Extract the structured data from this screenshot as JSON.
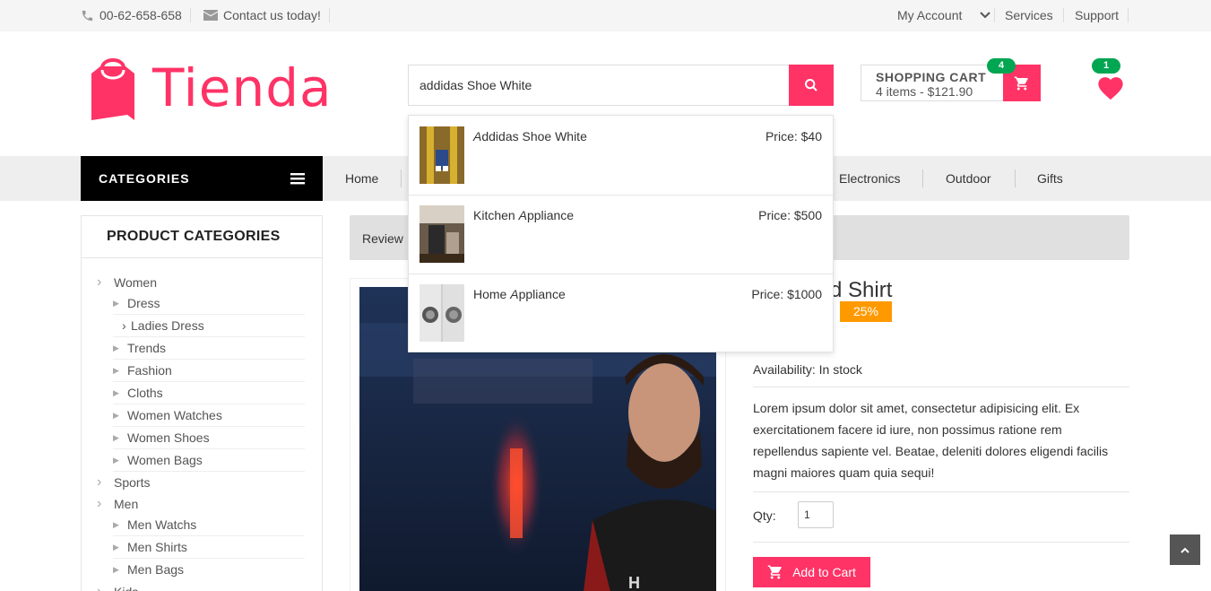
{
  "topbar": {
    "phone": "00-62-658-658",
    "contact": "Contact us today!",
    "account": "My Account",
    "services": "Services",
    "support": "Support"
  },
  "header": {
    "logo_text": "Tienda",
    "search_value": "addidas Shoe White",
    "cart_title": "SHOPPING CART",
    "cart_summary": "4 items - $121.90",
    "cart_count": "4",
    "wishlist_count": "1"
  },
  "nav": {
    "categories_label": "CATEGORIES",
    "links": [
      "Home",
      "Electronics",
      "Outdoor",
      "Gifts"
    ]
  },
  "sidebar": {
    "title": "PRODUCT CATEGORIES",
    "items": [
      {
        "label": "Women",
        "level": 0
      },
      {
        "label": "Dress",
        "level": 1
      },
      {
        "label": "Ladies Dress",
        "level": 2
      },
      {
        "label": "Trends",
        "level": 1
      },
      {
        "label": "Fashion",
        "level": 1
      },
      {
        "label": "Cloths",
        "level": 1
      },
      {
        "label": "Women Watches",
        "level": 1
      },
      {
        "label": "Women Shoes",
        "level": 1
      },
      {
        "label": "Women Bags",
        "level": 1
      },
      {
        "label": "Sports",
        "level": 0
      },
      {
        "label": "Men",
        "level": 0
      },
      {
        "label": "Men Watchs",
        "level": 1
      },
      {
        "label": "Men Shirts",
        "level": 1
      },
      {
        "label": "Men Bags",
        "level": 1
      },
      {
        "label": "Kids",
        "level": 0
      }
    ]
  },
  "breadcrumb": {
    "label": "Review"
  },
  "product": {
    "title": "d Shirt",
    "discount": "25%",
    "availability": "Availability: In stock",
    "description": "Lorem ipsum dolor sit amet, consectetur adipisicing elit. Ex exercitationem facere id iure, non possimus ratione rem repellendus sapiente vel. Beatae, deleniti dolores eligendi facilis magni maiores quam quia sequi!",
    "qty_label": "Qty:",
    "qty_value": "1",
    "add_to_cart": "Add to Cart"
  },
  "search_results": [
    {
      "name_a": "A",
      "name_b": "ddidas Shoe White",
      "price": "Price: $40"
    },
    {
      "name_a": "Kitchen ",
      "name_b": "A",
      "name_c": "ppliance",
      "price": "Price: $500"
    },
    {
      "name_a": "Home ",
      "name_b": "A",
      "name_c": "ppliance",
      "price": "Price: $1000"
    }
  ],
  "colors": {
    "accent": "#ff3366",
    "badge": "#00a651",
    "discount": "#ff9900"
  }
}
